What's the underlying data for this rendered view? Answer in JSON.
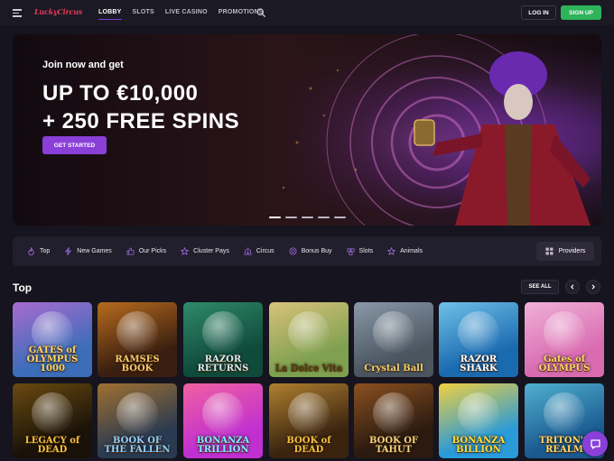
{
  "header": {
    "logo": "LuckyCircus",
    "nav": [
      {
        "label": "LOBBY",
        "active": true
      },
      {
        "label": "SLOTS",
        "active": false
      },
      {
        "label": "LIVE CASINO",
        "active": false
      },
      {
        "label": "PROMOTIONS",
        "active": false
      }
    ],
    "login_label": "LOG IN",
    "signup_label": "SIGN UP"
  },
  "hero": {
    "subtitle": "Join now and get",
    "title_line1": "UP TO €10,000",
    "title_line2": "+ 250 FREE SPINS",
    "cta_label": "GET STARTED",
    "slides": 5,
    "active_slide": 0
  },
  "categories": [
    {
      "label": "Top",
      "icon": "flame-icon"
    },
    {
      "label": "New Games",
      "icon": "lightning-icon"
    },
    {
      "label": "Our Picks",
      "icon": "thumbs-up-icon"
    },
    {
      "label": "Cluster Pays",
      "icon": "star-icon"
    },
    {
      "label": "Circus",
      "icon": "circus-tent-icon"
    },
    {
      "label": "Bonus Buy",
      "icon": "coin-icon"
    },
    {
      "label": "Slots",
      "icon": "slot-icon"
    },
    {
      "label": "Animals",
      "icon": "star-icon"
    }
  ],
  "providers_label": "Providers",
  "section": {
    "title": "Top",
    "see_all_label": "SEE ALL"
  },
  "games": [
    {
      "title": "GATES OF OLYMPUS 1000",
      "label": "GATES of OLYMPUS 1000",
      "bg": "#3b6db8",
      "bg2": "#a86bd0",
      "text": "#ffd86b"
    },
    {
      "title": "RAMSES BOOK",
      "label": "RAMSES BOOK",
      "bg": "#3a1f10",
      "bg2": "#b86b1e",
      "text": "#f2c86a"
    },
    {
      "title": "RAZOR RETURNS",
      "label": "RAZOR RETURNS",
      "bg": "#0f4a3a",
      "bg2": "#2f8a6a",
      "text": "#d8e8f0"
    },
    {
      "title": "La Dolce Vita",
      "label": "La Dolce Vita",
      "bg": "#7ea050",
      "bg2": "#d8c27a",
      "text": "#5a3a10"
    },
    {
      "title": "Crystal Ball",
      "label": "Crystal Ball",
      "bg": "#4a5560",
      "bg2": "#8a98a8",
      "text": "#f0d070"
    },
    {
      "title": "RAZOR SHARK",
      "label": "RAZOR SHARK",
      "bg": "#1a6ab0",
      "bg2": "#6fc0e8",
      "text": "#ffffff"
    },
    {
      "title": "GATES OF OLYMPUS",
      "label": "Gates of OLYMPUS",
      "bg": "#d86bb0",
      "bg2": "#f0b0d8",
      "text": "#ffd86b"
    },
    {
      "title": "LEGACY OF DEAD",
      "label": "LEGACY of DEAD",
      "bg": "#1a1208",
      "bg2": "#6a4a10",
      "text": "#f2c040"
    },
    {
      "title": "BOOK OF THE FALLEN",
      "label": "BOOK OF THE FALLEN",
      "bg": "#2a3a50",
      "bg2": "#a07030",
      "text": "#8fd0ff"
    },
    {
      "title": "BONANZA TRILLION",
      "label": "BONANZA TRILLION",
      "bg": "#c030d0",
      "bg2": "#f060a0",
      "text": "#7ff0ff"
    },
    {
      "title": "BOOK OF DEAD",
      "label": "BOOK of DEAD",
      "bg": "#3a2410",
      "bg2": "#b08030",
      "text": "#f2c040"
    },
    {
      "title": "BOOK OF TAHUT",
      "label": "BOOK OF TAHUT",
      "bg": "#2a1a10",
      "bg2": "#8a5020",
      "text": "#f0d080"
    },
    {
      "title": "BONANZA BILLION",
      "label": "BONANZA BILLION",
      "bg": "#2a9ad8",
      "bg2": "#f0d040",
      "text": "#ffe040"
    },
    {
      "title": "TRITON'S REALM",
      "label": "TRITON'S REALM",
      "bg": "#1a5a90",
      "bg2": "#50b0d0",
      "text": "#ffd86b"
    }
  ],
  "colors": {
    "accent": "#8a3fd9",
    "signup": "#2fb35a",
    "background": "#16141e",
    "bar": "#221f2c"
  }
}
